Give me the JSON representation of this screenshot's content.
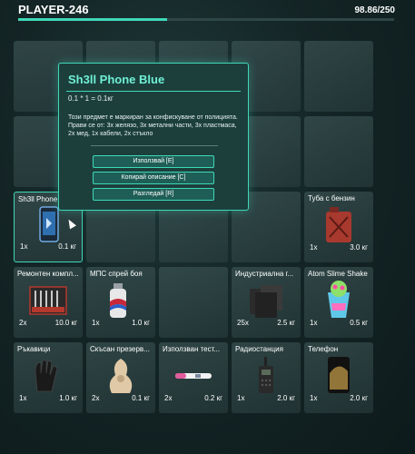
{
  "header": {
    "player": "PLAYER-246",
    "weight": "98.86/250",
    "weight_fraction": 0.395
  },
  "tooltip": {
    "title": "Sh3ll Phone Blue",
    "calc": "0.1 * 1 = 0.1кг",
    "description": "Този предмет е маркиран за конфискуване от полицията. Прави се от: 3х желязо, 3х метални части, 3х пластмаса, 2х мед, 1х кабели, 2х стъкло",
    "buttons": [
      "Използвай [E]",
      "Копирай описание [C]",
      "Разгледай [R]"
    ]
  },
  "slots": [
    {
      "name": "Sh3ll Phone",
      "qty": "1x",
      "weight": "0.1 кг",
      "icon": "phone-blue-icon"
    },
    {
      "name": "Туба с бензин",
      "qty": "1x",
      "weight": "3.0 кг",
      "icon": "gas-can-icon"
    },
    {
      "name": "Ремонтен компл...",
      "qty": "2x",
      "weight": "10.0 кг",
      "icon": "repair-kit-icon"
    },
    {
      "name": "МПС спрей боя",
      "qty": "1x",
      "weight": "1.0 кг",
      "icon": "spray-can-icon"
    },
    {
      "name": "Индустриална г...",
      "qty": "25x",
      "weight": "2.5 кг",
      "icon": "rubber-blocks-icon"
    },
    {
      "name": "Atom Slime Shake",
      "qty": "1x",
      "weight": "0.5 кг",
      "icon": "slime-shake-icon"
    },
    {
      "name": "Ръкавици",
      "qty": "1x",
      "weight": "1.0 кг",
      "icon": "gloves-icon"
    },
    {
      "name": "Скъсан презерв...",
      "qty": "2x",
      "weight": "0.1 кг",
      "icon": "torn-item-icon"
    },
    {
      "name": "Използван тест...",
      "qty": "2x",
      "weight": "0.2 кг",
      "icon": "test-stick-icon"
    },
    {
      "name": "Радиостанция",
      "qty": "1x",
      "weight": "2.0 кг",
      "icon": "radio-icon"
    },
    {
      "name": "Телефон",
      "qty": "1x",
      "weight": "2.0 кг",
      "icon": "phone-icon"
    }
  ]
}
